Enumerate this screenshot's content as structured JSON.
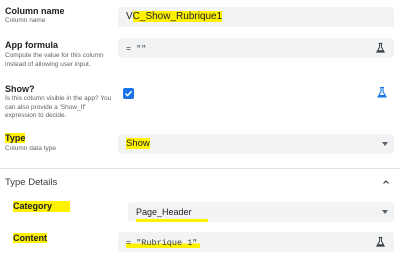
{
  "column_name": {
    "label": "Column name",
    "sublabel": "Column name",
    "value_prefix": "V",
    "value_highlighted": "C_Show_Rubrique1"
  },
  "app_formula": {
    "label": "App formula",
    "sublabel": "Compute the value for this column instead of allowing user input.",
    "value": "= \"\""
  },
  "show": {
    "label": "Show?",
    "sublabel": "Is this column visible in the app? You can also provide a 'Show_If' expression to decide.",
    "checked": true
  },
  "type": {
    "label": "Type",
    "sublabel": "Column data type",
    "value": "Show"
  },
  "type_details": {
    "title": "Type Details"
  },
  "category": {
    "label": "Category",
    "value": "Page_Header"
  },
  "content": {
    "label": "Content",
    "value": "= \"Rubrique 1\""
  },
  "colors": {
    "accent": "#1a73e8",
    "highlight": "#fff200",
    "field_bg": "#f1f3f4"
  },
  "icons": {
    "formula": "flask-icon",
    "show_formula": "flask-icon-blue",
    "dropdown": "chevron-down-icon",
    "collapse": "chevron-up-icon"
  }
}
